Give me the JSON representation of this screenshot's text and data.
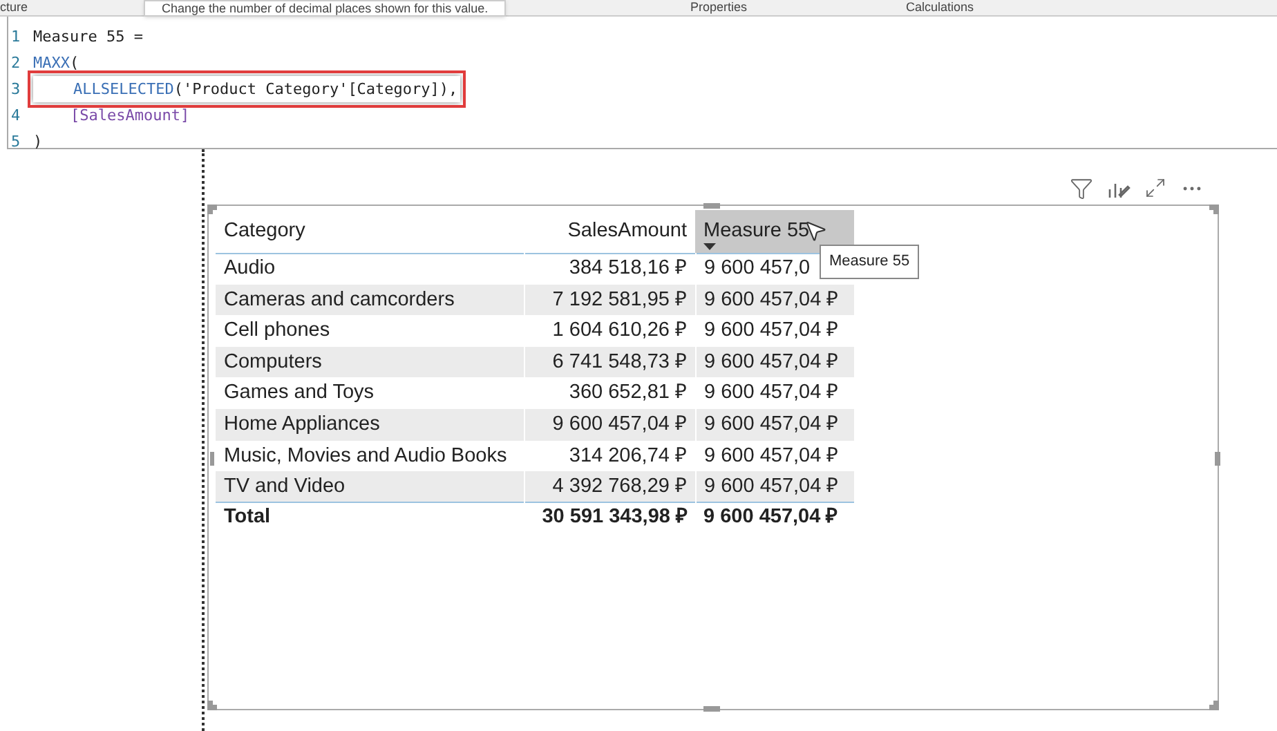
{
  "ribbon": {
    "tabs": [
      {
        "label": "cture",
        "selected": false
      },
      {
        "label": "Properties",
        "selected": false
      },
      {
        "label": "Calculations",
        "selected": false
      }
    ],
    "tooltip": "Change the number of decimal places shown for this value."
  },
  "formula_bar": {
    "lines": [
      {
        "number": "1",
        "highlighted": false,
        "tokens": [
          {
            "kind": "plain",
            "text": "Measure 55 ="
          }
        ]
      },
      {
        "number": "2",
        "highlighted": false,
        "tokens": [
          {
            "kind": "function",
            "text": "MAXX"
          },
          {
            "kind": "plain",
            "text": "("
          }
        ]
      },
      {
        "number": "3",
        "highlighted": true,
        "tokens": [
          {
            "kind": "indent"
          },
          {
            "kind": "function",
            "text": "ALLSELECTED"
          },
          {
            "kind": "plain",
            "text": "('Product Category'[Category]),"
          }
        ]
      },
      {
        "number": "4",
        "highlighted": false,
        "tokens": [
          {
            "kind": "indent"
          },
          {
            "kind": "measure",
            "text": "[SalesAmount]"
          }
        ]
      },
      {
        "number": "5",
        "highlighted": false,
        "tokens": [
          {
            "kind": "plain",
            "text": ")"
          }
        ]
      }
    ]
  },
  "table": {
    "columns": [
      {
        "label": "Category",
        "selected": false,
        "sorted": false
      },
      {
        "label": "SalesAmount",
        "selected": false,
        "sorted": false
      },
      {
        "label": "Measure 55",
        "selected": true,
        "sorted": true
      }
    ],
    "rows": [
      [
        "Audio",
        "384 518,16 ₽",
        "9 600 457,0"
      ],
      [
        "Cameras and camcorders",
        "7 192 581,95 ₽",
        "9 600 457,04 ₽"
      ],
      [
        "Cell phones",
        "1 604 610,26 ₽",
        "9 600 457,04 ₽"
      ],
      [
        "Computers",
        "6 741 548,73 ₽",
        "9 600 457,04 ₽"
      ],
      [
        "Games and Toys",
        "360 652,81 ₽",
        "9 600 457,04 ₽"
      ],
      [
        "Home Appliances",
        "9 600 457,04 ₽",
        "9 600 457,04 ₽"
      ],
      [
        "Music, Movies and Audio Books",
        "314 206,74 ₽",
        "9 600 457,04 ₽"
      ],
      [
        "TV and Video",
        "4 392 768,29 ₽",
        "9 600 457,04 ₽"
      ]
    ],
    "total": [
      "Total",
      "30 591 343,98 ₽",
      "9 600 457,04 ₽"
    ],
    "header_tooltip": "Measure 55"
  }
}
